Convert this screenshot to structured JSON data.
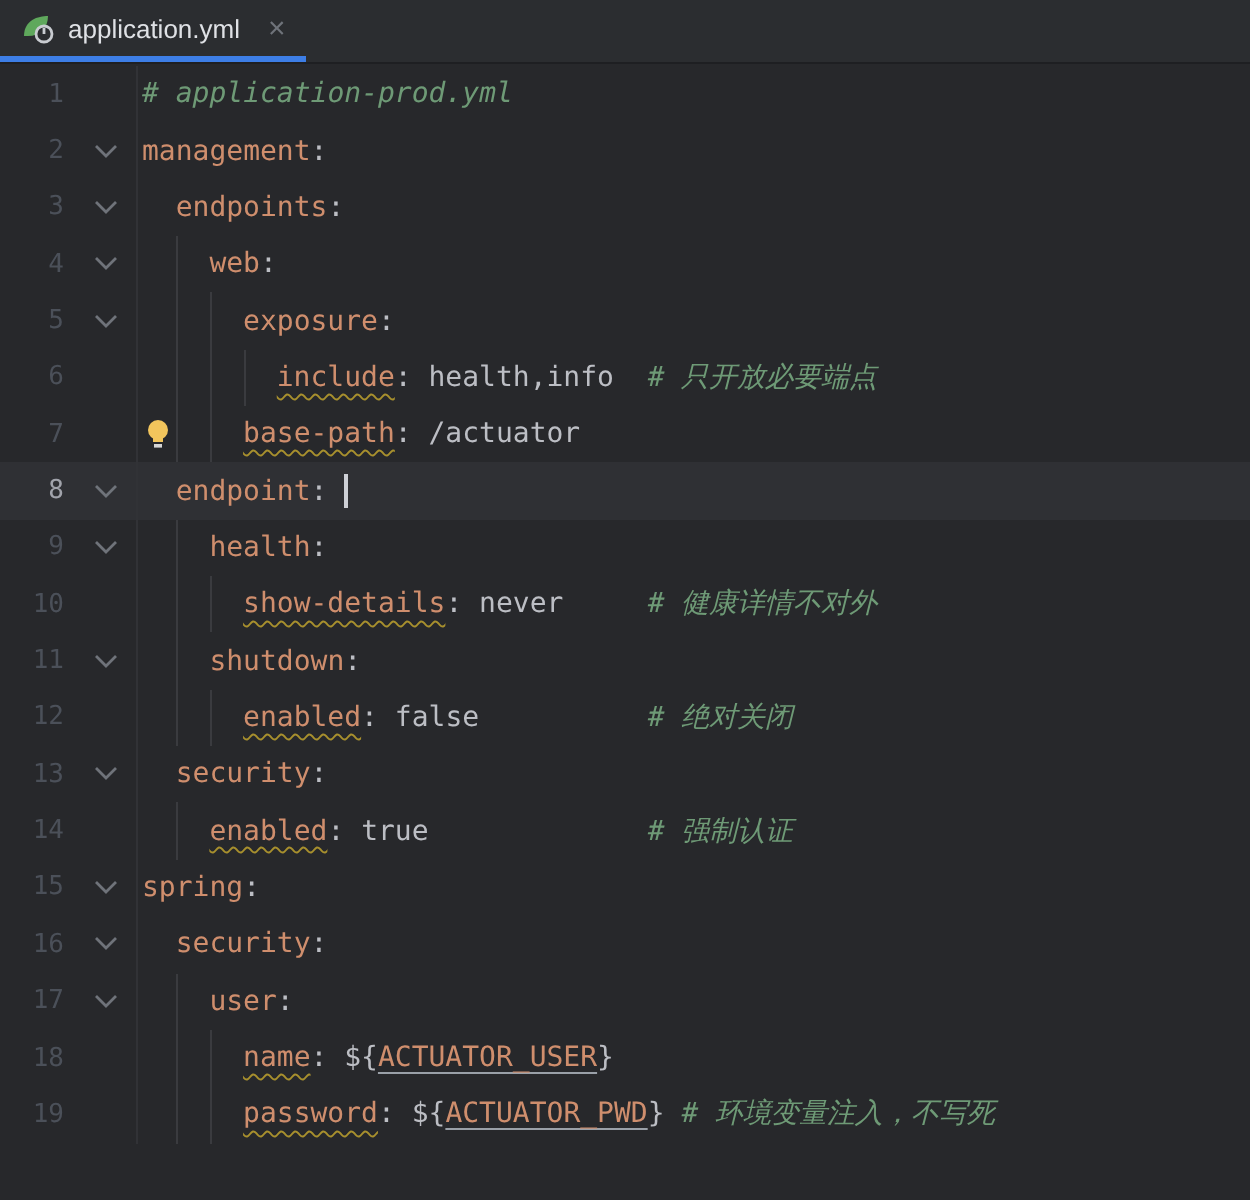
{
  "tabs": [
    {
      "label": "application.yml",
      "selected": true,
      "close": "×"
    }
  ],
  "lines": [
    {
      "number": "1",
      "kind": "plain",
      "comment": "# application-prod.yml"
    },
    {
      "number": "2",
      "kind": "plain",
      "tokens": [
        {
          "kind": "key",
          "text": "management"
        },
        {
          "kind": "punct",
          "text": ":"
        }
      ],
      "children": [
        {
          "number": "3",
          "kind": "plain",
          "tokens": [
            {
              "kind": "key",
              "text": "endpoints"
            },
            {
              "kind": "punct",
              "text": ":"
            }
          ],
          "children": [
            {
              "number": "4",
              "kind": "plain",
              "tokens": [
                {
                  "kind": "key",
                  "text": "web"
                },
                {
                  "kind": "punct",
                  "text": ":"
                }
              ],
              "children": [
                {
                  "number": "5",
                  "kind": "plain",
                  "tokens": [
                    {
                      "kind": "key",
                      "text": "exposure"
                    },
                    {
                      "kind": "punct",
                      "text": ":"
                    }
                  ],
                  "children": [
                    {
                      "number": "6",
                      "kind": "plain",
                      "tokens": [
                        {
                          "kind": "flagged_key",
                          "text": "include"
                        },
                        {
                          "kind": "punct",
                          "text": ":"
                        },
                        {
                          "kind": "value",
                          "text": "health,info"
                        }
                      ],
                      "comment": "# 只开放必要端点"
                    }
                  ]
                },
                {
                  "number": "7",
                  "kind": "hint",
                  "tokens": [
                    {
                      "kind": "flagged_key",
                      "text": "base-path"
                    },
                    {
                      "kind": "punct",
                      "text": ":"
                    },
                    {
                      "kind": "value",
                      "text": "/actuator"
                    }
                  ]
                }
              ]
            }
          ]
        },
        {
          "number": "8",
          "kind": "current",
          "tokens": [
            {
              "kind": "key",
              "text": "endpoint"
            },
            {
              "kind": "punct",
              "text": ":"
            }
          ],
          "children": [
            {
              "number": "9",
              "kind": "plain",
              "tokens": [
                {
                  "kind": "key",
                  "text": "health"
                },
                {
                  "kind": "punct",
                  "text": ":"
                }
              ],
              "children": [
                {
                  "number": "10",
                  "kind": "plain",
                  "tokens": [
                    {
                      "kind": "flagged_key",
                      "text": "show-details"
                    },
                    {
                      "kind": "punct",
                      "text": ":"
                    },
                    {
                      "kind": "value",
                      "text": "never"
                    }
                  ],
                  "comment": "# 健康详情不对外"
                }
              ]
            },
            {
              "number": "11",
              "kind": "plain",
              "tokens": [
                {
                  "kind": "key",
                  "text": "shutdown"
                },
                {
                  "kind": "punct",
                  "text": ":"
                }
              ],
              "children": [
                {
                  "number": "12",
                  "kind": "plain",
                  "tokens": [
                    {
                      "kind": "flagged_key",
                      "text": "enabled"
                    },
                    {
                      "kind": "punct",
                      "text": ":"
                    },
                    {
                      "kind": "value",
                      "text": "false"
                    }
                  ],
                  "comment": "# 绝对关闭"
                }
              ]
            }
          ]
        },
        {
          "number": "13",
          "kind": "plain",
          "tokens": [
            {
              "kind": "key",
              "text": "security"
            },
            {
              "kind": "punct",
              "text": ":"
            }
          ],
          "children": [
            {
              "number": "14",
              "kind": "plain",
              "tokens": [
                {
                  "kind": "flagged_key",
                  "text": "enabled"
                },
                {
                  "kind": "punct",
                  "text": ":"
                },
                {
                  "kind": "value",
                  "text": "true"
                }
              ],
              "comment": "# 强制认证"
            }
          ]
        }
      ]
    },
    {
      "number": "15",
      "kind": "plain",
      "tokens": [
        {
          "kind": "key",
          "text": "spring"
        },
        {
          "kind": "punct",
          "text": ":"
        }
      ],
      "children": [
        {
          "number": "16",
          "kind": "plain",
          "tokens": [
            {
              "kind": "key",
              "text": "security"
            },
            {
              "kind": "punct",
              "text": ":"
            }
          ],
          "children": [
            {
              "number": "17",
              "kind": "plain",
              "tokens": [
                {
                  "kind": "key",
                  "text": "user"
                },
                {
                  "kind": "punct",
                  "text": ":"
                }
              ],
              "children": [
                {
                  "number": "18",
                  "kind": "plain",
                  "tokens": [
                    {
                      "kind": "flagged_key",
                      "text": "name"
                    },
                    {
                      "kind": "punct",
                      "text": ":"
                    },
                    {
                      "kind": "value",
                      "text": "${"
                    },
                    {
                      "kind": "variable",
                      "text": "ACTUATOR_USER"
                    },
                    {
                      "kind": "value",
                      "text": "}"
                    }
                  ]
                },
                {
                  "number": "19",
                  "kind": "plain",
                  "tokens": [
                    {
                      "kind": "flagged_key",
                      "text": "password"
                    },
                    {
                      "kind": "punct",
                      "text": ":"
                    },
                    {
                      "kind": "value",
                      "text": "${"
                    },
                    {
                      "kind": "variable",
                      "text": "ACTUATOR_PWD"
                    },
                    {
                      "kind": "value",
                      "text": "}"
                    }
                  ],
                  "comment": "# 环境变量注入，不写死"
                }
              ]
            }
          ]
        }
      ]
    }
  ]
}
